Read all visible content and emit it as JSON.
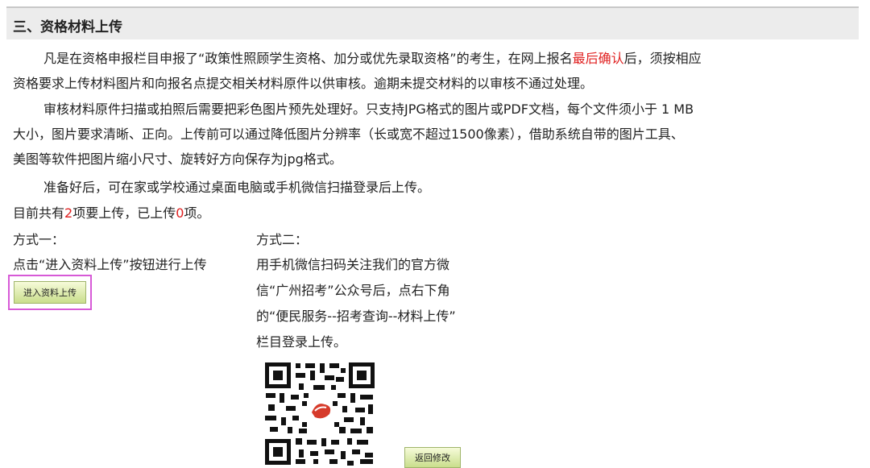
{
  "section": {
    "title": "三、资格材料上传"
  },
  "intro": {
    "p1_part1": "凡是在资格申报栏目申报了“政策性照顾学生资格、加分或优先录取资格”的考生，在网上报名",
    "p1_red": "最后确认",
    "p1_part2": "后，须按相应",
    "p1_line2": "资格要求上传材料图片和向报名点提交相关材料原件以供审核。逾期未提交材料的以审核不通过处理。",
    "p2_line1": "审核材料原件扫描或拍照后需要把彩色图片预先处理好。只支持JPG格式的图片或PDF文档，每个文件须小于 1 MB",
    "p2_line2": "大小，图片要求清晰、正向。上传前可以通过降低图片分辨率（长或宽不超过1500像素），借助系统自带的图片工具、",
    "p2_line3": "美图等软件把图片缩小尺寸、旋转好方向保存为jpg格式。",
    "p3": "准备好后，可在家或学校通过桌面电脑或手机微信扫描登录后上传。"
  },
  "status": {
    "prefix": "目前共有",
    "total": "2",
    "middle": "项要上传，已上传",
    "uploaded": "0",
    "suffix": "项。"
  },
  "method1": {
    "title": "方式一：",
    "desc": "点击“进入资料上传”按钮进行上传",
    "button_label": "进入资料上传"
  },
  "method2": {
    "title": "方式二：",
    "line1": "用手机微信扫码关注我们的官方微",
    "line2": "信“广州招考”公众号后，点右下角",
    "line3": "的“便民服务--招考查询--材料上传”",
    "line4": "栏目登录上传。",
    "qr_icon": "qr-code-icon"
  },
  "footer": {
    "back_label": "返回修改"
  },
  "colors": {
    "header_bg": "#ececec",
    "highlight_red": "#e02020",
    "button_green": "#c9de8c",
    "focus_outline": "#d75ad7"
  }
}
